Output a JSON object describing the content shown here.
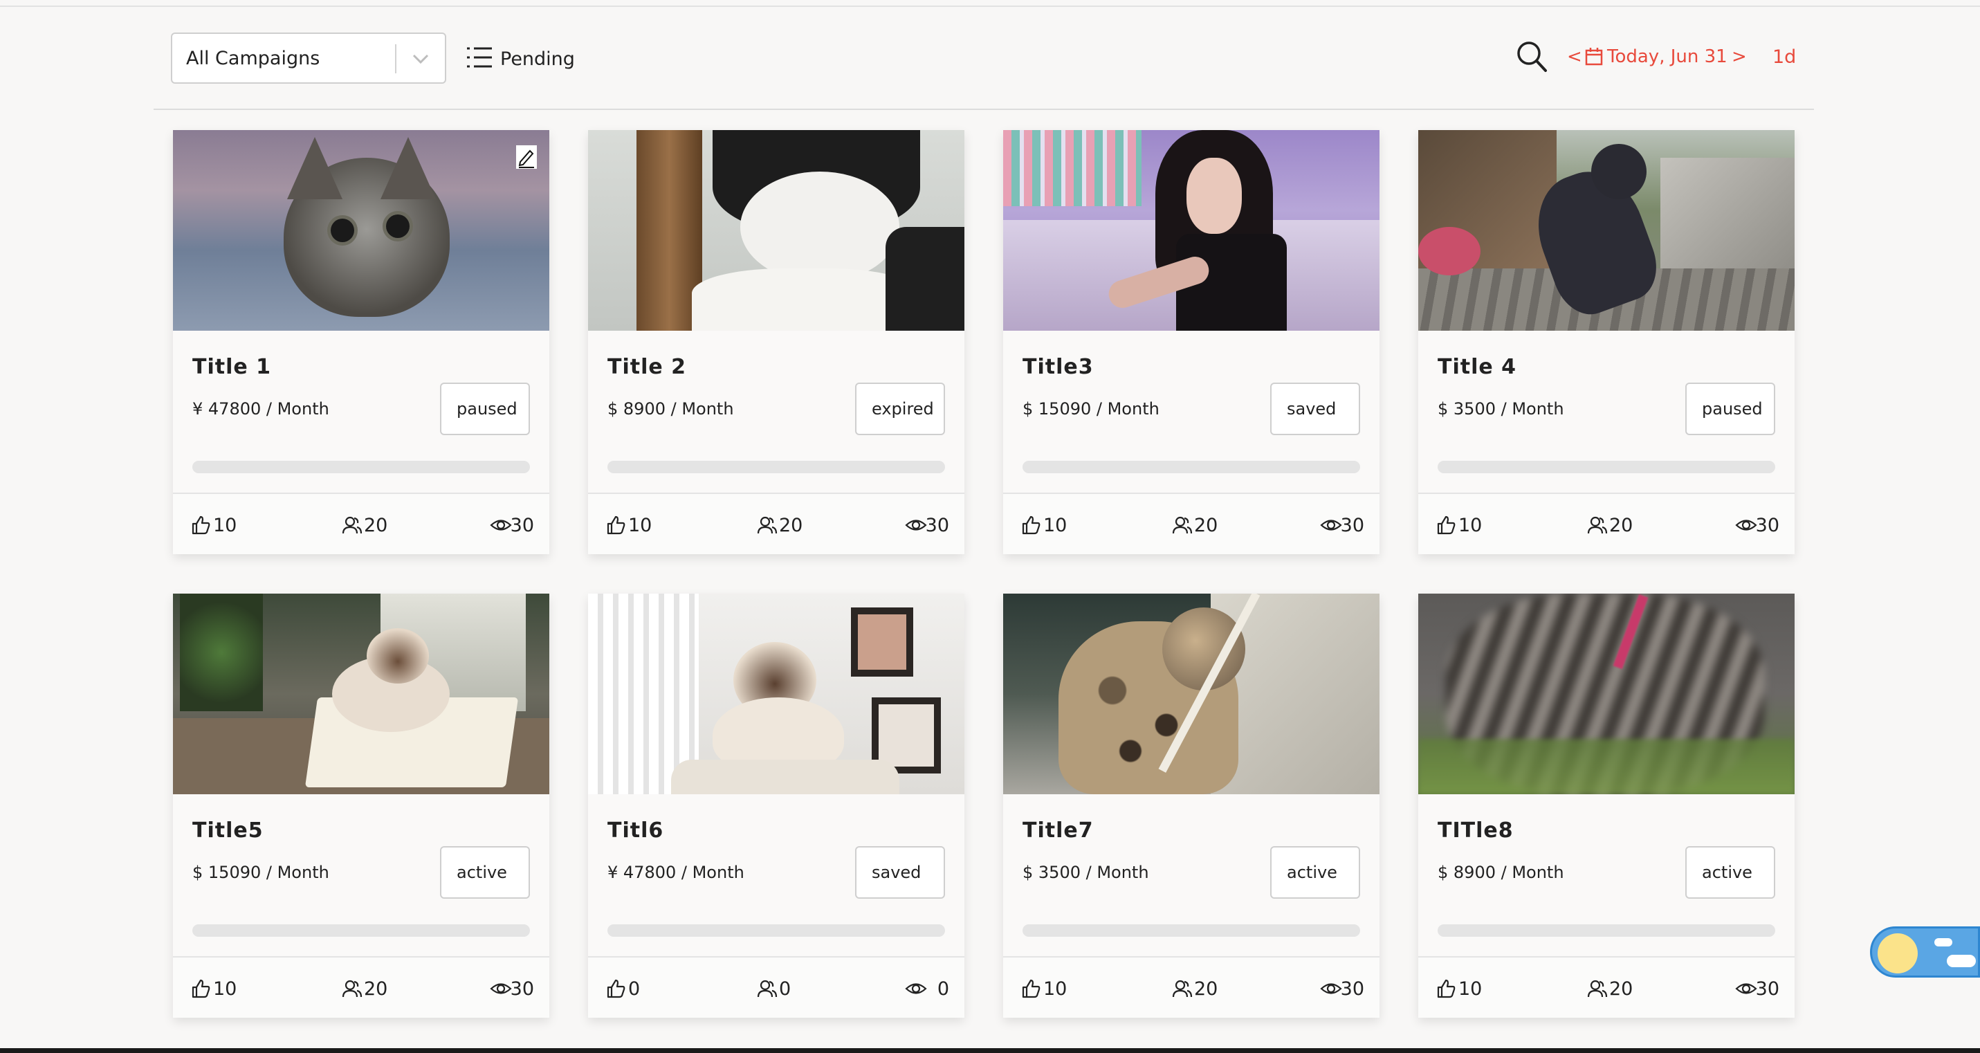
{
  "toolbar": {
    "campaign_select": "All Campaigns",
    "filter_label": "Pending",
    "date_prev": "<",
    "date_label": "Today, Jun 31",
    "date_next": ">",
    "range": "1d"
  },
  "colors": {
    "accent": "#e84a3c",
    "card_bg": "#faf9f8",
    "page_bg": "#f8f7f6",
    "progress_track": "#e4e4e4",
    "toggle_blue": "#5aa6e4",
    "toggle_sun": "#fbe38a"
  },
  "icons": {
    "select": "chevron-down-icon",
    "filter": "list-icon",
    "search": "search-icon",
    "date": "calendar-icon",
    "edit": "pencil-icon",
    "likes": "thumbs-up-icon",
    "users": "users-icon",
    "views": "eye-icon",
    "theme": "sun-cloud-toggle-icon"
  },
  "cards": [
    {
      "title": "Title 1",
      "price": "¥ 47800 / Month",
      "status": "paused",
      "progress": 0,
      "likes": "10",
      "users": "20",
      "views": "30",
      "image": "kitten-tabby-closeup",
      "editable": true
    },
    {
      "title": "Title 2",
      "price": "$ 8900 / Month",
      "status": "expired",
      "progress": 0,
      "likes": "10",
      "users": "20",
      "views": "30",
      "image": "black-white-cat",
      "editable": false
    },
    {
      "title": "Title3",
      "price": "$ 15090 / Month",
      "status": "saved",
      "progress": 0,
      "likes": "10",
      "users": "20",
      "views": "30",
      "image": "woman-on-sofa",
      "editable": false
    },
    {
      "title": "Title 4",
      "price": "$ 3500 / Month",
      "status": "paused",
      "progress": 0,
      "likes": "10",
      "users": "20",
      "views": "30",
      "image": "cat-statue-street",
      "editable": false
    },
    {
      "title": "Title5",
      "price": "$ 15090 / Month",
      "status": "active",
      "progress": 0,
      "likes": "10",
      "users": "20",
      "views": "30",
      "image": "siamese-cat-on-book",
      "editable": false
    },
    {
      "title": "Titl6",
      "price": "¥ 47800 / Month",
      "status": "saved",
      "progress": 0,
      "likes": "0",
      "users": "0",
      "views": "0",
      "image": "ragdoll-kitten-indoor",
      "editable": false
    },
    {
      "title": "Title7",
      "price": "$ 3500 / Month",
      "status": "active",
      "progress": 0,
      "likes": "10",
      "users": "20",
      "views": "30",
      "image": "spotted-kitten",
      "editable": false
    },
    {
      "title": "TITle8",
      "price": "$ 8900 / Month",
      "status": "active",
      "progress": 0,
      "likes": "10",
      "users": "20",
      "views": "30",
      "image": "motion-blur-cat",
      "editable": false
    }
  ]
}
